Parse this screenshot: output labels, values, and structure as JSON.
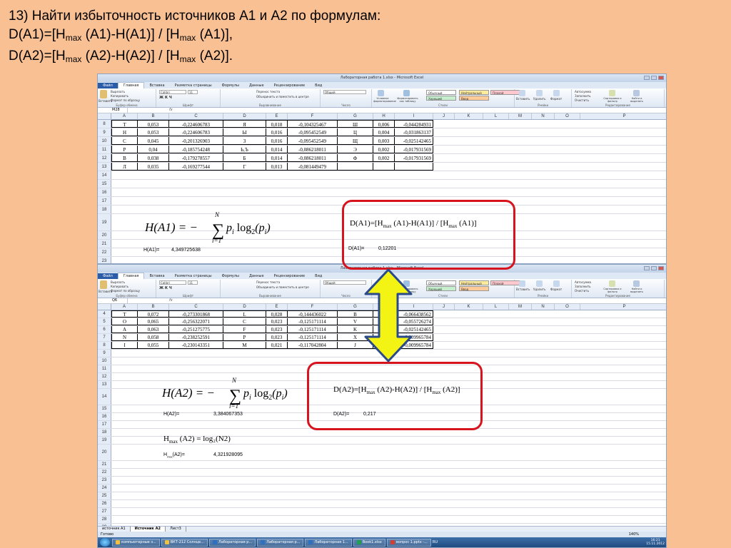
{
  "title": {
    "line1": "13) Найти избыточность источников A1 и A2 по формулам:",
    "line2_pre": "D(A1)=[H",
    "line2_sub": "max",
    "line2_mid": " (A1)-H(A1)] / [H",
    "line2_sub2": "max",
    "line2_post": " (A1)],",
    "line3_pre": "D(A2)=[H",
    "line3_sub": "max",
    "line3_mid": " (A2)-H(A2)] / [H",
    "line3_sub2": "max",
    "line3_post": " (A2)]."
  },
  "excel": {
    "window_title": "Лабораторная работа 1.xlsx - Microsoft Excel",
    "tabs": [
      "Файл",
      "Главная",
      "Вставка",
      "Разметка страницы",
      "Формулы",
      "Данные",
      "Рецензирование",
      "Вид"
    ],
    "ribbon": {
      "clipboard": [
        "Вырезать",
        "Копировать",
        "Формат по образцу"
      ],
      "clipboard_label": "Буфер обмена",
      "paste": "Вставить",
      "font_name": "Calibri",
      "font_size": "11",
      "font_label": "Шрифт",
      "align": [
        "Перенос текста",
        "Объединить и поместить в центре"
      ],
      "align_label": "Выравнивание",
      "number_format": "Общий",
      "number_label": "Число",
      "cond_format": "Условное форматирование",
      "table_format": "Форматировать как таблицу",
      "styles": [
        "Обычный",
        "Нейтральный",
        "Плохой",
        "Хороший",
        "Ввод"
      ],
      "styles_label": "Стили",
      "cells": [
        "Вставить",
        "Удалить",
        "Формат"
      ],
      "cells_label": "Ячейки",
      "edit": [
        "Автосумма",
        "Заполнить",
        "Очистить"
      ],
      "sort": "Сортировка и фильтр",
      "find": "Найти и выделить",
      "edit_label": "Редактирование"
    },
    "columns": [
      "A",
      "B",
      "C",
      "D",
      "E",
      "F",
      "G",
      "H",
      "I",
      "J",
      "K",
      "L",
      "M",
      "N",
      "O",
      "P"
    ]
  },
  "sheetA": {
    "namebox": "M28",
    "rows": [
      {
        "n": "8",
        "A": "Т",
        "B": "0,053",
        "C": "-0,224606783",
        "D": "Я",
        "E": "0,018",
        "F": "-0,104325467",
        "G": "Ш",
        "H": "0,006",
        "I": "-0,044284931"
      },
      {
        "n": "9",
        "A": "Н",
        "B": "0,053",
        "C": "-0,224606783",
        "D": "Ы",
        "E": "0,016",
        "F": "-0,095452549",
        "G": "Ц",
        "H": "0,004",
        "I": "-0,031863137"
      },
      {
        "n": "10",
        "A": "С",
        "B": "0,045",
        "C": "-0,201326903",
        "D": "З",
        "E": "0,016",
        "F": "-0,095452549",
        "G": "Щ",
        "H": "0,003",
        "I": "-0,025142465"
      },
      {
        "n": "11",
        "A": "Р",
        "B": "0,04",
        "C": "-0,185754248",
        "D": "Ь,Ъ",
        "E": "0,014",
        "F": "-0,086218011",
        "G": "Э",
        "H": "0,002",
        "I": "-0,017931569"
      },
      {
        "n": "12",
        "A": "В",
        "B": "0,038",
        "C": "-0,179278557",
        "D": "Б",
        "E": "0,014",
        "F": "-0,086218011",
        "G": "Ф",
        "H": "0,002",
        "I": "-0,017931569"
      },
      {
        "n": "13",
        "A": "Л",
        "B": "0,035",
        "C": "-0,169277544",
        "D": "Г",
        "E": "0,013",
        "F": "-0,081449479",
        "G": "",
        "H": "",
        "I": ""
      }
    ],
    "empty_rows": [
      "14",
      "15",
      "16",
      "17",
      "18",
      "19",
      "20",
      "21",
      "22",
      "23"
    ],
    "h_label": "H(A1)=",
    "h_value": "4,349725638",
    "formula_H": "H(A1) = −",
    "formula_sum_top": "N",
    "formula_sum_bottom": "i=1",
    "formula_tail": "pᵢ log₂(pᵢ)",
    "box_formula_pre": "D(A1)=[H",
    "box_formula_sub": "max",
    "box_formula_mid": " (A1)-H(A1)] / [H",
    "box_formula_sub2": "max",
    "box_formula_post": " (A1)]",
    "d_label": "D(A1)=",
    "d_value": "0,12201"
  },
  "sheetB": {
    "namebox": "Q6",
    "rows": [
      {
        "n": "4",
        "A": "T",
        "B": "0,072",
        "C": "-0,273301868",
        "D": "L",
        "E": "0,028",
        "F": "-0,144436022",
        "G": "B",
        "H": "0,0",
        "I": "-0,066438562"
      },
      {
        "n": "5",
        "A": "O",
        "B": "0,065",
        "C": "-0,256322071",
        "D": "C",
        "E": "0,023",
        "F": "-0,125171114",
        "G": "V",
        "H": "0,0",
        "I": "-0,055726274"
      },
      {
        "n": "6",
        "A": "A",
        "B": "0,063",
        "C": "-0,251275775",
        "D": "F",
        "E": "0,023",
        "F": "-0,125171114",
        "G": "K",
        "H": "0,0",
        "I": "-0,025142465"
      },
      {
        "n": "7",
        "A": "N",
        "B": "0,058",
        "C": "-0,238252591",
        "D": "P",
        "E": "0,023",
        "F": "-0,125171114",
        "G": "X",
        "H": "0,0",
        "I": "-0,009965784"
      },
      {
        "n": "8",
        "A": "I",
        "B": "0,055",
        "C": "-0,230143351",
        "D": "M",
        "E": "0,021",
        "F": "-0,117042804",
        "G": "J",
        "H": "0,0",
        "I": "-0,009965784"
      }
    ],
    "empty_rows": [
      "9",
      "10",
      "11",
      "12",
      "13",
      "14",
      "15",
      "16",
      "17",
      "18",
      "19",
      "20",
      "21",
      "22",
      "23",
      "24",
      "25",
      "26",
      "27",
      "28",
      "29"
    ],
    "h_label": "H(A2)=",
    "h_value": "3,384067353",
    "formula_H": "H(A2) = −",
    "formula_sum_top": "N",
    "formula_sum_bottom": "i=1",
    "formula_tail": "pᵢ log₂(pᵢ)",
    "hmax_formula_pre": "H",
    "hmax_formula_sub": "max",
    "hmax_formula_post": " (A2) = log₂(N2)",
    "hmax_label_pre": "H",
    "hmax_label_sub": "max",
    "hmax_label_post": "(A2)=",
    "hmax_value": "4,321928095",
    "box_formula_pre": "D(A2)=[H",
    "box_formula_sub": "max",
    "box_formula_mid": " (A2)-H(A2)] / [H",
    "box_formula_sub2": "max",
    "box_formula_post": " (A2)]",
    "d_label": "D(A2)=",
    "d_value": "0,217",
    "sheets": [
      "источник A1",
      "Источник A2",
      "Лист3"
    ],
    "status": "Готово",
    "zoom": "140%"
  },
  "taskbar": {
    "buttons": [
      "компьютерные з...",
      "ВКТ-212 Солнце...",
      "Лабораторная р...",
      "Лабораторная р...",
      "Лабораторная 1...",
      "Book1.xlsx",
      "вопрос 1.pptx -..."
    ],
    "lang": "RU",
    "time": "16:21",
    "date": "15.11.2012"
  },
  "colors": {
    "background": "#f9c094",
    "highlight": "#d7141e",
    "arrow_fill": "#f4f414",
    "arrow_stroke": "#2b4a8a"
  }
}
